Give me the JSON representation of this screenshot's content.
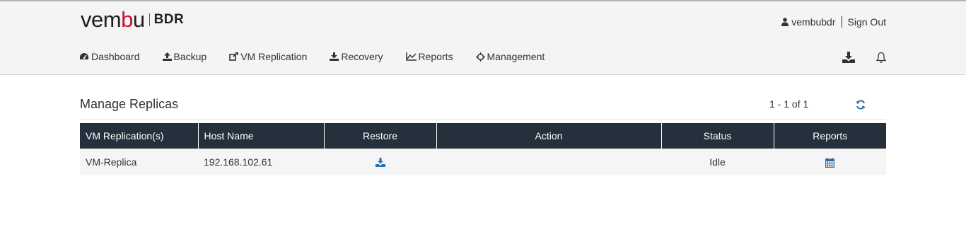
{
  "brand": {
    "logo_main": "vem",
    "logo_accent": "b",
    "logo_tail": "u",
    "product": "BDR"
  },
  "user": {
    "username": "vembubdr",
    "signout_label": "Sign Out"
  },
  "nav": {
    "items": [
      {
        "label": "Dashboard",
        "icon": "dashboard-icon"
      },
      {
        "label": "Backup",
        "icon": "upload-icon"
      },
      {
        "label": "VM Replication",
        "icon": "external-link-icon"
      },
      {
        "label": "Recovery",
        "icon": "download-icon"
      },
      {
        "label": "Reports",
        "icon": "line-chart-icon"
      },
      {
        "label": "Management",
        "icon": "crosshair-icon"
      }
    ],
    "right_icons": [
      "download-tray-icon",
      "bell-icon"
    ]
  },
  "page": {
    "title": "Manage Replicas",
    "pager": "1 - 1 of 1",
    "refresh_icon": "refresh-icon"
  },
  "table": {
    "headers": [
      "VM Replication(s)",
      "Host Name",
      "Restore",
      "Action",
      "Status",
      "Reports"
    ],
    "rows": [
      {
        "vm": "VM-Replica",
        "host": "192.168.102.61",
        "restore_icon": "restore-download-icon",
        "action": "",
        "status": "Idle",
        "reports_icon": "calendar-icon"
      }
    ]
  },
  "colors": {
    "header_bg": "#f4f4f4",
    "table_header_bg": "#24303c",
    "accent_blue": "#2a6fb0",
    "logo_red": "#c8102e"
  }
}
